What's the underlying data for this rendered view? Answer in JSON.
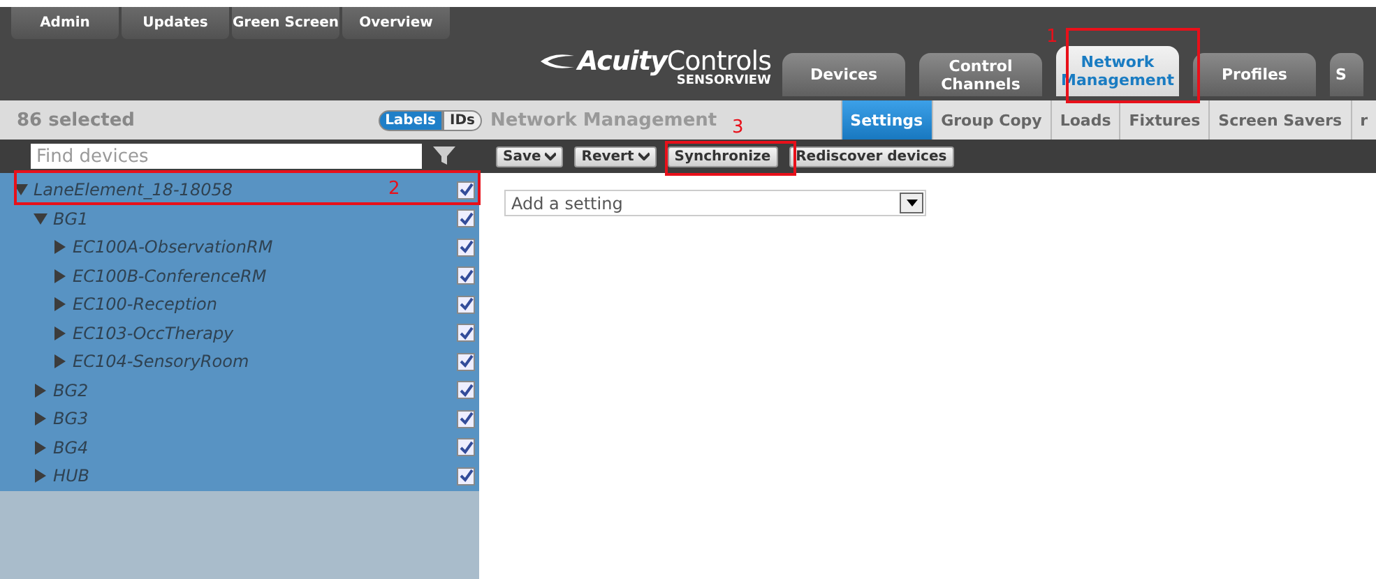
{
  "top_tabs": [
    {
      "label": "Admin"
    },
    {
      "label": "Updates"
    },
    {
      "label": "Green Screen"
    },
    {
      "label": "Overview"
    }
  ],
  "logo": {
    "brand_bold": "Acuity",
    "brand_light": "Controls",
    "product": "SENSORVIEW"
  },
  "main_tabs": [
    {
      "label": "Devices",
      "selected": false
    },
    {
      "label": "Control Channels",
      "selected": false
    },
    {
      "label": "Network Management",
      "selected": true
    },
    {
      "label": "Profiles",
      "selected": false
    },
    {
      "label": "S",
      "selected": false
    }
  ],
  "selection_count": "86 selected",
  "view_toggle": [
    {
      "label": "Labels",
      "selected": true
    },
    {
      "label": "IDs",
      "selected": false
    }
  ],
  "section_title": "Network Management",
  "sub_tabs": [
    {
      "label": "Settings",
      "selected": true
    },
    {
      "label": "Group Copy",
      "selected": false
    },
    {
      "label": "Loads",
      "selected": false
    },
    {
      "label": "Fixtures",
      "selected": false
    },
    {
      "label": "Screen Savers",
      "selected": false
    },
    {
      "label": "r",
      "selected": false
    }
  ],
  "search": {
    "placeholder": "Find devices"
  },
  "toolbar": [
    {
      "label": "Save",
      "kind": "dropdown"
    },
    {
      "label": "Revert",
      "kind": "dropdown"
    },
    {
      "label": "Synchronize",
      "kind": "button"
    },
    {
      "label": "Rediscover devices",
      "kind": "button"
    }
  ],
  "tree": [
    {
      "label": "LaneElement_18-18058",
      "expanded": true,
      "checked": true,
      "children": [
        {
          "label": "BG1",
          "expanded": true,
          "checked": true,
          "children": [
            {
              "label": "EC100A-ObservationRM",
              "expanded": false,
              "checked": true
            },
            {
              "label": "EC100B-ConferenceRM",
              "expanded": false,
              "checked": true
            },
            {
              "label": "EC100-Reception",
              "expanded": false,
              "checked": true
            },
            {
              "label": "EC103-OccTherapy",
              "expanded": false,
              "checked": true
            },
            {
              "label": "EC104-SensoryRoom",
              "expanded": false,
              "checked": true
            }
          ]
        },
        {
          "label": "BG2",
          "expanded": false,
          "checked": true
        },
        {
          "label": "BG3",
          "expanded": false,
          "checked": true
        },
        {
          "label": "BG4",
          "expanded": false,
          "checked": true
        },
        {
          "label": "HUB",
          "expanded": false,
          "checked": true
        }
      ]
    }
  ],
  "setting_select": {
    "placeholder": "Add a setting"
  },
  "annotations": [
    {
      "number": "1"
    },
    {
      "number": "2"
    },
    {
      "number": "3"
    }
  ]
}
